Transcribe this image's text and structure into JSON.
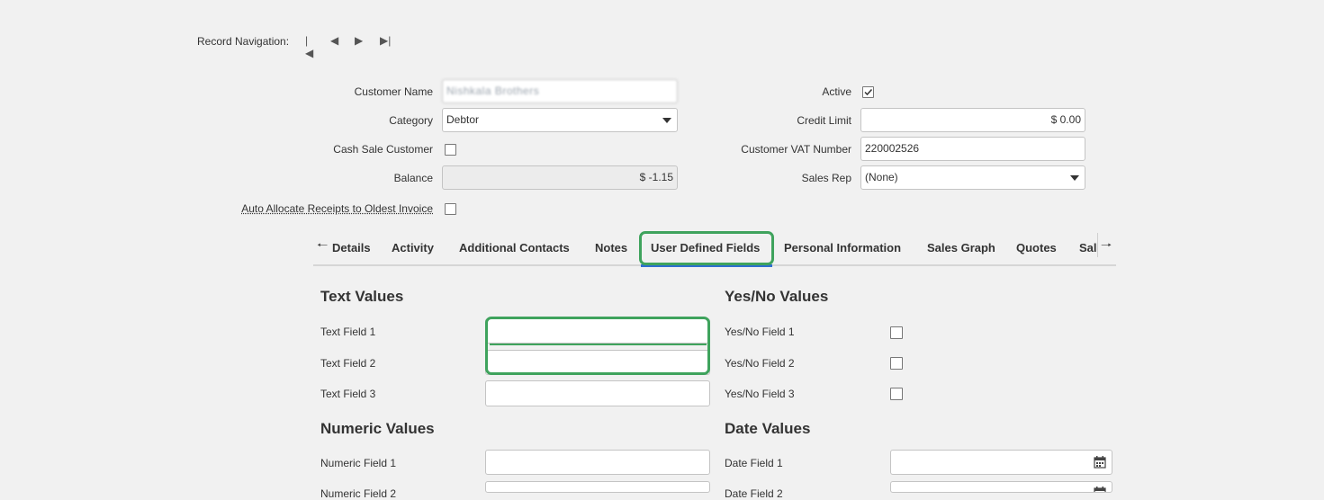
{
  "record_navigation": {
    "label": "Record Navigation:",
    "first_glyph": "|◀",
    "prev_glyph": "◀",
    "next_glyph": "▶",
    "last_glyph": "▶|"
  },
  "customer_form": {
    "customer_name": {
      "label": "Customer Name",
      "value": "Nishkala Brothers"
    },
    "category": {
      "label": "Category",
      "value": "Debtor"
    },
    "cash_sale_customer": {
      "label": "Cash Sale Customer",
      "checked": false
    },
    "balance": {
      "label": "Balance",
      "value": "$ -1.15"
    },
    "auto_allocate": {
      "label": "Auto Allocate Receipts to Oldest Invoice",
      "checked": false
    },
    "active": {
      "label": "Active",
      "checked": true
    },
    "credit_limit": {
      "label": "Credit Limit",
      "value": "$ 0.00"
    },
    "customer_vat_number": {
      "label": "Customer VAT Number",
      "value": "220002526"
    },
    "sales_rep": {
      "label": "Sales Rep",
      "value": "(None)"
    }
  },
  "tabs": {
    "scroll_left_glyph": "🠐",
    "scroll_right_glyph": "🠒",
    "items": [
      {
        "label": "Details"
      },
      {
        "label": "Activity"
      },
      {
        "label": "Additional Contacts"
      },
      {
        "label": "Notes"
      },
      {
        "label": "User Defined Fields",
        "active": true
      },
      {
        "label": "Personal Information"
      },
      {
        "label": "Sales Graph"
      },
      {
        "label": "Quotes"
      },
      {
        "label": "Sal"
      }
    ]
  },
  "user_defined_fields": {
    "text_values": {
      "title": "Text Values",
      "fields": [
        {
          "label": "Text Field 1",
          "value": ""
        },
        {
          "label": "Text Field 2",
          "value": ""
        },
        {
          "label": "Text Field 3",
          "value": ""
        }
      ]
    },
    "yes_no_values": {
      "title": "Yes/No Values",
      "fields": [
        {
          "label": "Yes/No Field 1",
          "checked": false
        },
        {
          "label": "Yes/No Field 2",
          "checked": false
        },
        {
          "label": "Yes/No Field 3",
          "checked": false
        }
      ]
    },
    "numeric_values": {
      "title": "Numeric Values",
      "fields": [
        {
          "label": "Numeric Field 1",
          "value": ""
        },
        {
          "label": "Numeric Field 2",
          "value": ""
        }
      ]
    },
    "date_values": {
      "title": "Date Values",
      "fields": [
        {
          "label": "Date Field 1",
          "value": ""
        },
        {
          "label": "Date Field 2",
          "value": ""
        }
      ]
    }
  },
  "colors": {
    "highlight": "#3fa35d",
    "active_tab_underline": "#2f6fcf"
  }
}
